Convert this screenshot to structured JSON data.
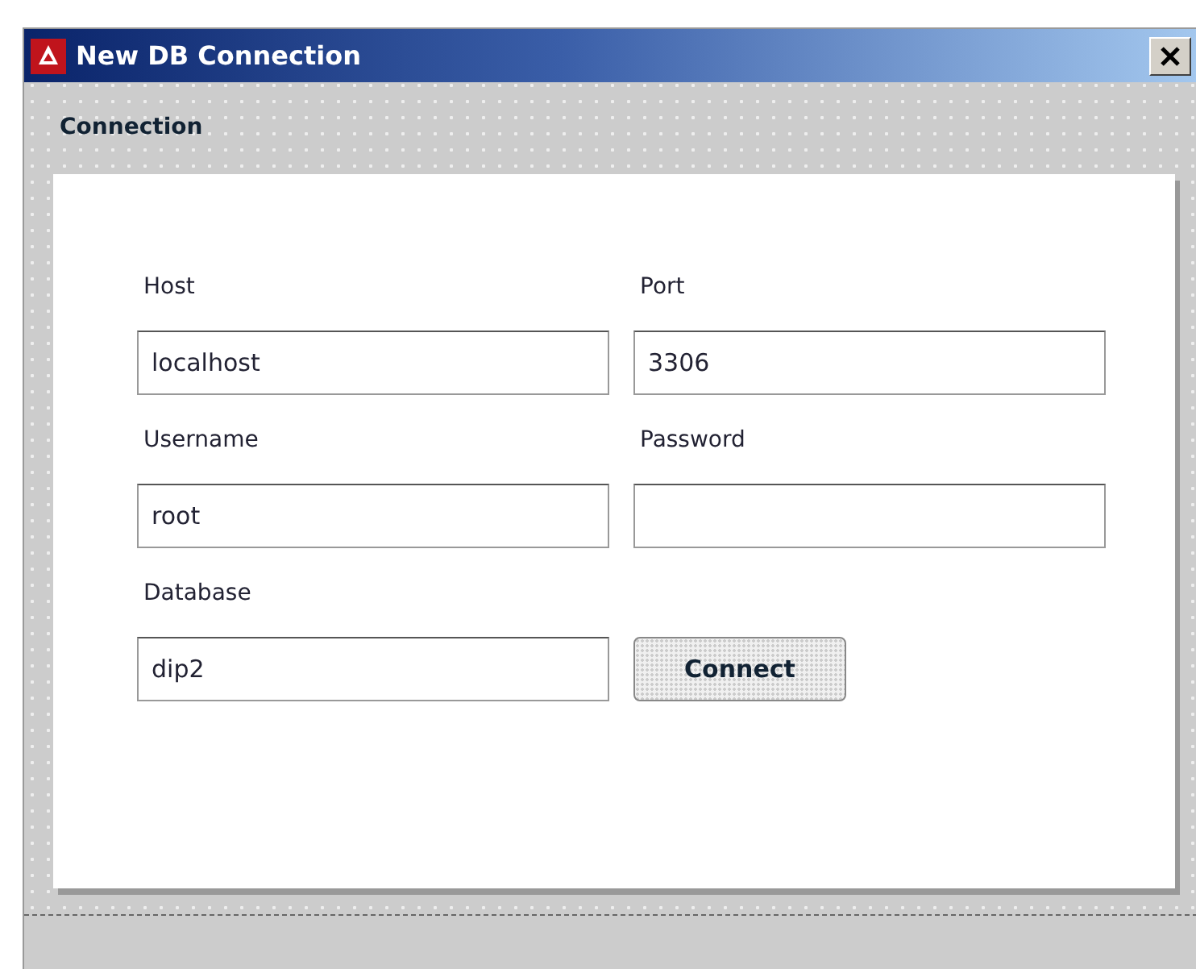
{
  "window": {
    "title": "New DB Connection"
  },
  "section": {
    "title": "Connection"
  },
  "fields": [
    {
      "label": "Host",
      "value": "localhost"
    },
    {
      "label": "Port",
      "value": "3306"
    },
    {
      "label": "Username",
      "value": "root"
    },
    {
      "label": "Password"
    },
    {
      "label": "Database",
      "value": "dip2"
    }
  ],
  "buttons": [
    "Connect"
  ]
}
